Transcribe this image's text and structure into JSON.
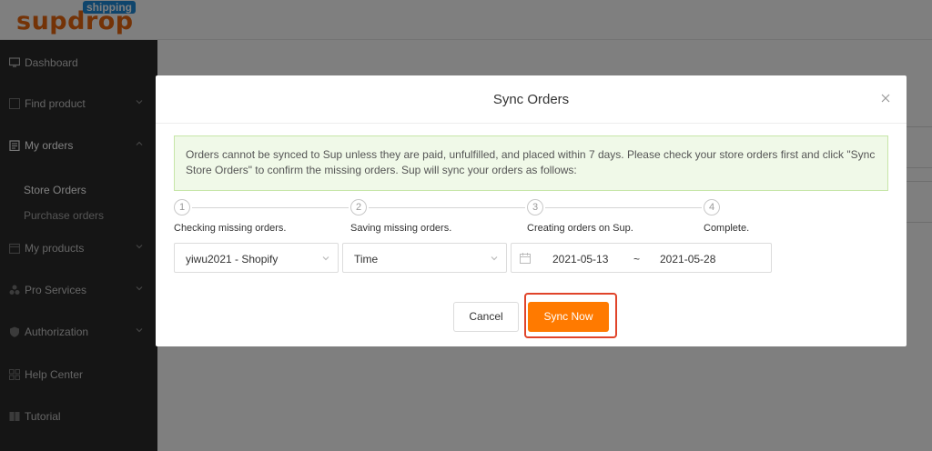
{
  "brand": {
    "name": "supdrop",
    "badge": "shipping",
    "color": "#e8660f",
    "badge_color": "#1f8ad8"
  },
  "sidebar": {
    "items": [
      {
        "label": "Dashboard",
        "icon": "monitor-icon"
      },
      {
        "label": "Find product",
        "icon": "search-icon",
        "chevron": "chevron-down-icon"
      },
      {
        "label": "My orders",
        "icon": "clipboard-icon",
        "chevron": "chevron-up-icon"
      },
      {
        "label": "My products",
        "icon": "box-icon",
        "chevron": "chevron-down-icon"
      },
      {
        "label": "Pro Services",
        "icon": "cubes-icon",
        "chevron": "chevron-down-icon"
      },
      {
        "label": "Authorization",
        "icon": "shield-icon",
        "chevron": "chevron-down-icon"
      },
      {
        "label": "Help Center",
        "icon": "grid-icon"
      },
      {
        "label": "Tutorial",
        "icon": "book-icon"
      }
    ],
    "sub_items": [
      {
        "label": "Store Orders",
        "active": true
      },
      {
        "label": "Purchase orders",
        "active": false
      }
    ]
  },
  "modal": {
    "title": "Sync Orders",
    "close_icon": "close-icon",
    "notice": "Orders cannot be synced to Sup unless they are paid, unfulfilled, and placed within 7 days. Please check your store orders first and click \"Sync Store Orders\" to confirm the missing orders. Sup will sync your orders as follows:",
    "steps": [
      {
        "number": "1",
        "label": "Checking missing orders."
      },
      {
        "number": "2",
        "label": "Saving missing orders."
      },
      {
        "number": "3",
        "label": "Creating orders on Sup."
      },
      {
        "number": "4",
        "label": "Complete."
      }
    ],
    "store_select": {
      "value": "yiwu2021 - Shopify"
    },
    "time_select": {
      "value": "Time"
    },
    "date_range": {
      "start": "2021-05-13",
      "separator": "~",
      "end": "2021-05-28"
    },
    "cancel_label": "Cancel",
    "sync_label": "Sync Now",
    "accent_color": "#ff7a00",
    "highlight_color": "#e0442a"
  }
}
